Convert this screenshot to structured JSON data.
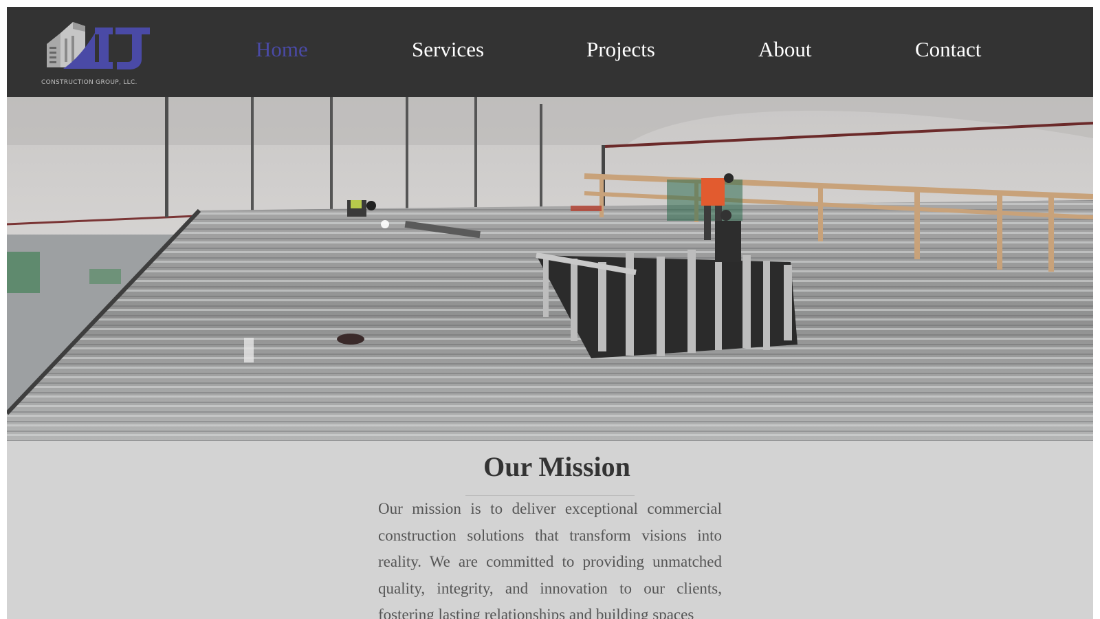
{
  "brand": {
    "logo_letters": "IJ",
    "tagline": "CONSTRUCTION GROUP, LLC.",
    "accent_color": "#4a4aa6"
  },
  "nav": {
    "items": [
      {
        "label": "Home",
        "active": true
      },
      {
        "label": "Services",
        "active": false
      },
      {
        "label": "Projects",
        "active": false
      },
      {
        "label": "About",
        "active": false
      },
      {
        "label": "Contact",
        "active": false
      }
    ]
  },
  "hero": {
    "image": "photo-of-mezzanine-steel-decking-construction-with-workers"
  },
  "mission": {
    "title": "Our Mission",
    "text": "Our mission is to deliver exceptional commercial construction solutions that transform visions into reality. We are committed to providing unmatched quality, integrity, and innovation to our clients, fostering lasting relationships and building spaces"
  },
  "colors": {
    "header_bg": "#333333",
    "page_bg": "#d3d3d3",
    "heading": "#333333",
    "body_text": "#555555"
  }
}
